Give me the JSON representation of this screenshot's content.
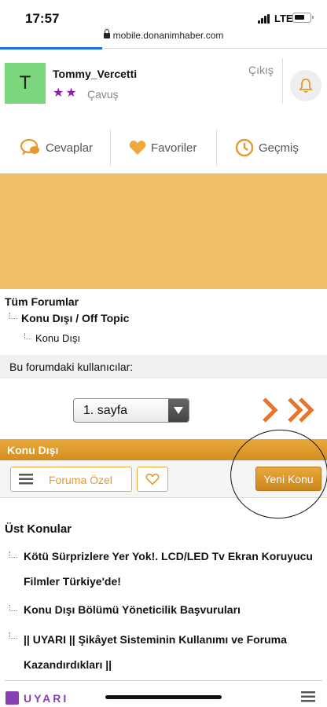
{
  "status": {
    "time": "17:57",
    "network": "LTE"
  },
  "browser": {
    "url": "mobile.donanimhaber.com"
  },
  "user": {
    "initial": "T",
    "name": "Tommy_Vercetti",
    "stars": "★★",
    "rank": "Çavuş",
    "logout": "Çıkış"
  },
  "quick_links": {
    "replies": "Cevaplar",
    "favorites": "Favoriler",
    "history": "Geçmiş"
  },
  "breadcrumb": {
    "all_forums": "Tüm Forumlar",
    "section": "Konu Dışı / Off Topic",
    "subsection": "Konu Dışı"
  },
  "forum_users_label": "Bu forumdaki kullanıcılar:",
  "pager": {
    "selected": "1. sayfa"
  },
  "forum": {
    "title": "Konu Dışı",
    "filter_label": "Foruma Özel",
    "new_topic": "Yeni Konu"
  },
  "top_topics": {
    "header": "Üst Konular",
    "items": [
      "Kötü Sürprizlere Yer Yok!. LCD/LED Tv Ekran Koruyucu Filmler Türkiye'de!",
      "Konu Dışı Bölümü Yöneticilik Başvuruları",
      "|| UYARI || Şikâyet Sisteminin Kullanımı ve Foruma Kazandırdıkları ||"
    ]
  },
  "bottom": {
    "warning_label": "UYARI"
  },
  "colors": {
    "accent": "#e39a2e",
    "banner": "#f2c068",
    "rank_star": "#8b1fb5",
    "pager_arrow": "#e8742a"
  }
}
